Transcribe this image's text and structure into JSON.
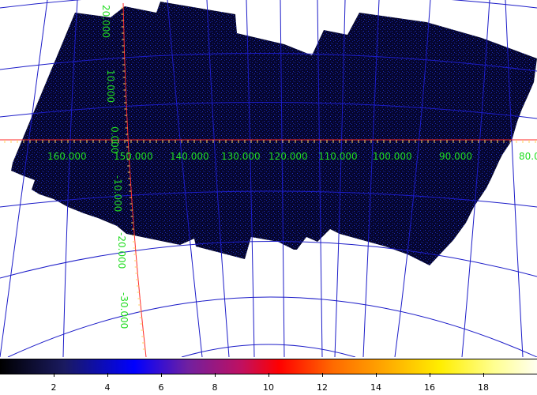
{
  "image": {
    "background_color": "#ffffff",
    "survey_fill_color": "#05052e",
    "survey_noise_color": "#1a2aa8",
    "grid_color": "#1c1cc8",
    "axis_color": "#ff2a2a",
    "label_color": "#22dd22"
  },
  "axes": {
    "longitude_labels": [
      "160.000",
      "150.000",
      "140.000",
      "130.000",
      "120.000",
      "110.000",
      "100.000",
      "90.000",
      "80.0"
    ],
    "latitude_labels": [
      "20.000",
      "10.000",
      "0.000",
      "-10.000",
      "-20.000",
      "-30.000"
    ]
  },
  "colorbar": {
    "colormap": "heat",
    "min": 0,
    "max": 20,
    "tick_labels": [
      "2",
      "4",
      "6",
      "8",
      "10",
      "12",
      "14",
      "16",
      "18"
    ]
  }
}
